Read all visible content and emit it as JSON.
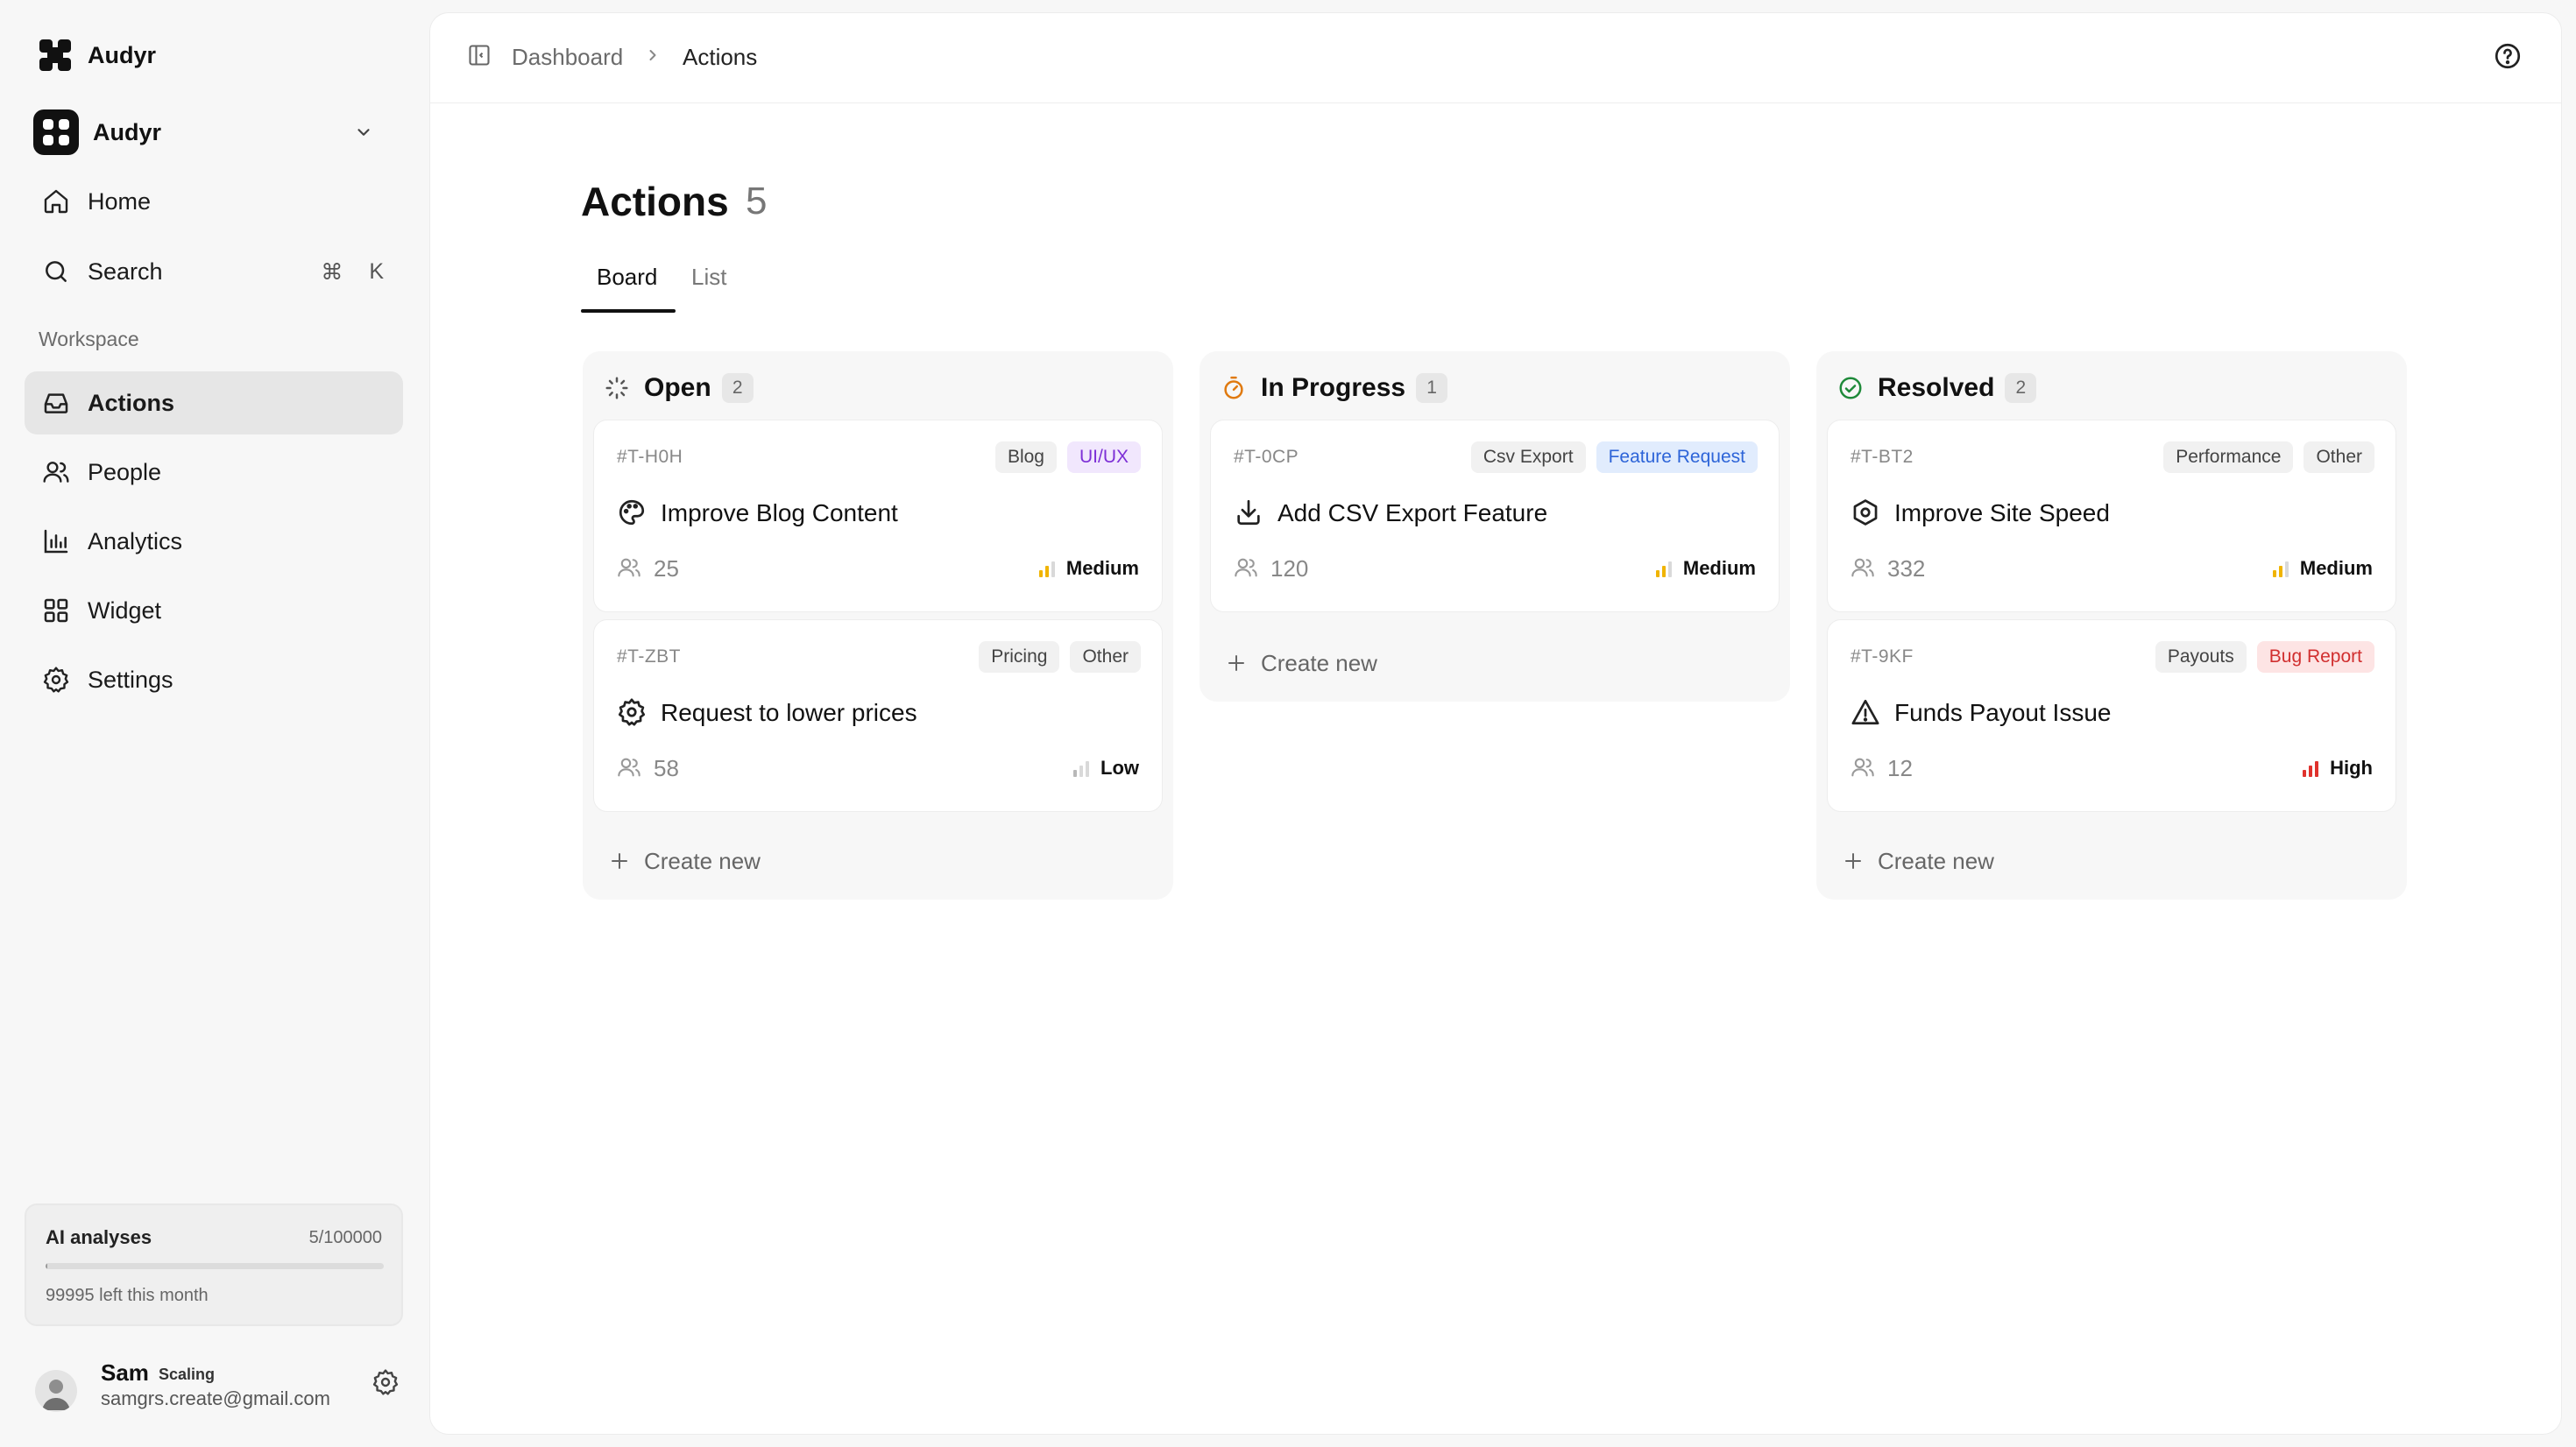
{
  "app": {
    "name": "Audyr"
  },
  "workspace": {
    "name": "Audyr"
  },
  "nav": {
    "home": "Home",
    "search": "Search",
    "search_shortcut_mod": "⌘",
    "search_shortcut_key": "K",
    "section": "Workspace",
    "items": [
      {
        "label": "Actions",
        "icon": "inbox-icon",
        "active": true
      },
      {
        "label": "People",
        "icon": "users-icon"
      },
      {
        "label": "Analytics",
        "icon": "bar-chart-icon"
      },
      {
        "label": "Widget",
        "icon": "grid-icon"
      },
      {
        "label": "Settings",
        "icon": "gear-icon"
      }
    ]
  },
  "usage": {
    "title": "AI analyses",
    "count": "5/100000",
    "used_fraction": 5e-05,
    "remaining": "99995 left this month"
  },
  "user": {
    "name": "Sam",
    "plan": "Scaling",
    "email": "samgrs.create@gmail.com"
  },
  "breadcrumb": {
    "parent": "Dashboard",
    "current": "Actions"
  },
  "page": {
    "title": "Actions",
    "count": "5"
  },
  "tabs": {
    "board": "Board",
    "list": "List",
    "active": "Board"
  },
  "colors": {
    "medium": "#f0b400",
    "high": "#e0322d",
    "low_bar": "#b8b8b8",
    "in_progress": "#e07a10",
    "resolved": "#1f8a3a"
  },
  "columns": [
    {
      "title": "Open",
      "count": "2",
      "icon": "loader-icon",
      "create_label": "Create new",
      "cards": [
        {
          "id": "#T-H0H",
          "tags": [
            "Blog",
            "UI/UX"
          ],
          "title": "Improve Blog Content",
          "icon": "palette-icon",
          "users": "25",
          "priority": "Medium"
        },
        {
          "id": "#T-ZBT",
          "tags": [
            "Pricing",
            "Other"
          ],
          "title": "Request to lower prices",
          "icon": "gear-icon",
          "users": "58",
          "priority": "Low"
        }
      ]
    },
    {
      "title": "In Progress",
      "count": "1",
      "icon": "timer-icon",
      "create_label": "Create new",
      "cards": [
        {
          "id": "#T-0CP",
          "tags": [
            "Csv Export",
            "Feature Request"
          ],
          "title": "Add CSV Export Feature",
          "icon": "download-icon",
          "users": "120",
          "priority": "Medium"
        }
      ]
    },
    {
      "title": "Resolved",
      "count": "2",
      "icon": "check-circle-icon",
      "create_label": "Create new",
      "cards": [
        {
          "id": "#T-BT2",
          "tags": [
            "Performance",
            "Other"
          ],
          "title": "Improve Site Speed",
          "icon": "hexagon-icon",
          "users": "332",
          "priority": "Medium"
        },
        {
          "id": "#T-9KF",
          "tags": [
            "Payouts",
            "Bug Report"
          ],
          "title": "Funds Payout Issue",
          "icon": "alert-triangle-icon",
          "users": "12",
          "priority": "High"
        }
      ]
    }
  ]
}
